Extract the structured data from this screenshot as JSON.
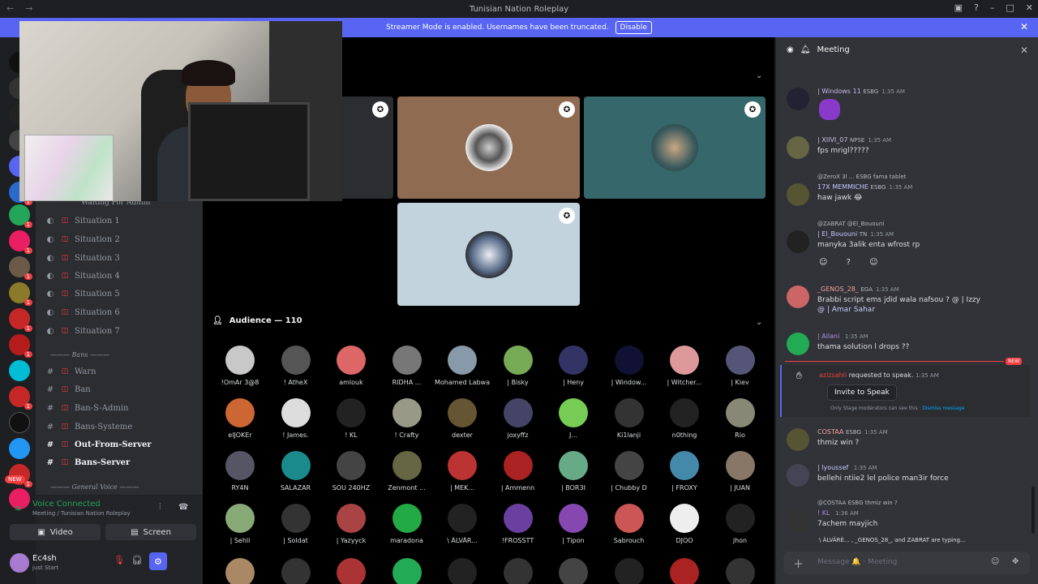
{
  "window": {
    "title": "Tunisian Nation Roleplay"
  },
  "banner": {
    "text": "Streamer Mode is enabled. Usernames have been truncated.",
    "button": "Disable"
  },
  "rail": {
    "badge_new": "NEW",
    "badges": [
      "1",
      "1",
      "1",
      "1",
      "1",
      "1",
      "1",
      "1",
      "1",
      "1",
      "1",
      "1"
    ]
  },
  "channels": {
    "waiting": "Waiting For Admin",
    "situations": [
      "Situation 1",
      "Situation 2",
      "Situation 3",
      "Situation 4",
      "Situation 5",
      "Situation 6",
      "Situation 7"
    ],
    "bans_category": "Bans",
    "text_channels": [
      "Warn",
      "Ban",
      "Ban-S-Admin",
      "Bans-Systeme",
      "Out-From-Server",
      "Bans-Server"
    ],
    "general_category": "General Voice"
  },
  "voice": {
    "status": "Voice Connected",
    "location": "Meeting / Tunisian Nation Roleplay",
    "video_label": "Video",
    "screen_label": "Screen"
  },
  "user": {
    "name": "Ec4sh",
    "status": "just Start"
  },
  "audience": {
    "title": "Audience — 110",
    "members": [
      "!OmAr 3@8",
      "! AtheX",
      "amlouk",
      "RIDHA ...",
      "Mohamed Labwani",
      "| Bisky",
      "| Heny",
      "| Window...",
      "| Witcher...",
      "| Kiev",
      "elJOKEr",
      "! James. ",
      "! KL",
      "! Crafty",
      "dexter",
      "joxyffz",
      "J...",
      "Ki1lanji",
      "n0thing",
      "Rio",
      "RY4N",
      "SALAZAR",
      "SOU 240HZ",
      "Zenmont ...",
      "| MEK...",
      "| Ammenn",
      "| BOR3I",
      "| Chubby D",
      "| FROXY",
      "| JUAN",
      "| Sehli",
      "| Soldat",
      "| Yazyyck",
      "maradona",
      "\\ ÀLVÄR...",
      "!FROSSTT",
      "| Tipon",
      "Sabrouch",
      "DJOO",
      "jhon"
    ]
  },
  "chat": {
    "channel": "Meeting",
    "placeholder": "Message 🔔 · Meeting",
    "new_label": "NEW",
    "messages": [
      {
        "user": "| Windows 11",
        "tag": "ESBG",
        "time": "1:35 AM",
        "text": ""
      },
      {
        "user": "| XIIVI_07",
        "tag": "NPSE",
        "time": "1:35 AM",
        "text": "fps mrigl?????"
      },
      {
        "reply": "@ZeroX 3l ... ESBG fama tablet",
        "user": "17X MEMMICHE",
        "tag": "ESBG",
        "time": "1:35 AM",
        "text": "haw jawk 😂"
      },
      {
        "reply": "@ZABRAT @El_Bououni",
        "user": "| El_Bououni",
        "tag": "TN",
        "time": "1:35 AM",
        "text": "manyka 3alik enta wfrost rp"
      },
      {
        "user": "_GENOS_28_",
        "tag": "EGA",
        "time": "1:35 AM",
        "text": "Brabbi script ems jdid wala nafsou ? @ | Izzy",
        "text2": "@ | Amar Sahar"
      },
      {
        "user": "| Allani",
        "tag": "",
        "time": "1:35 AM",
        "text": "thama solution l drops ??"
      },
      {
        "user": "COSTAA",
        "tag": "ESBG",
        "time": "1:35 AM",
        "text": "thmiz win ?"
      },
      {
        "user": "| lyoussef",
        "tag": "",
        "time": "1:35 AM",
        "text": "bellehi ntiie2 lel police man3ir force"
      },
      {
        "reply": "@COSTAA ESBG thmiz win ?",
        "user": "! KL",
        "tag": "",
        "time": "1:36 AM",
        "text": "7achem mayjich"
      }
    ],
    "speak_request": {
      "user": "azizsahli",
      "text": "requested to speak.",
      "time": "1:35 AM",
      "button": "Invite to Speak",
      "note": "Only Stage moderators can see this ·",
      "dismiss": "Dismiss message"
    },
    "typing": "\\ ÀLVÄRÈ... , _GENOS_28_, and ZABRAT are typing..."
  }
}
